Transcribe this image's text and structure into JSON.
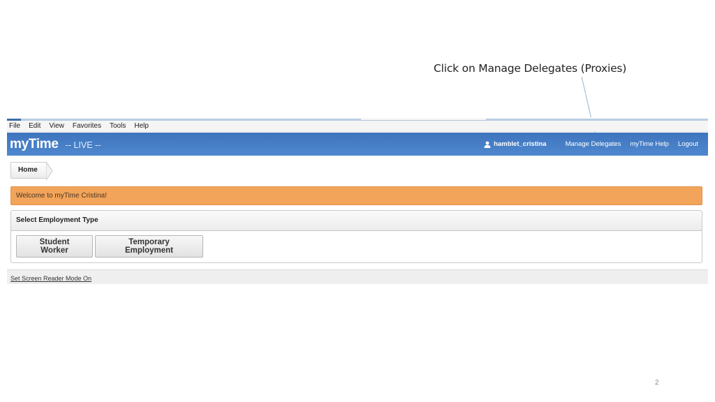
{
  "annotation": {
    "callout_text": "Click on Manage Delegates (Proxies)"
  },
  "browser": {
    "menu": [
      "File",
      "Edit",
      "View",
      "Favorites",
      "Tools",
      "Help"
    ]
  },
  "app": {
    "title": "myTime",
    "environment": "-- LIVE --",
    "username": "hamblet_cristina",
    "user_icon": "user-icon",
    "nav_links": [
      "Manage Delegates",
      "myTime Help",
      "Logout"
    ]
  },
  "breadcrumb": {
    "home": "Home"
  },
  "welcome_message": "Welcome to myTime Cristina!",
  "employment_panel": {
    "header": "Select Employment Type",
    "buttons": [
      "Student Worker",
      "Temporary Employment"
    ]
  },
  "footer": {
    "screen_reader_link": "Set Screen Reader Mode On"
  },
  "slide": {
    "number": "2"
  },
  "colors": {
    "app_bar": "#4a80c8",
    "welcome_bg": "#f2a45b",
    "callout_line": "#7fa3c9"
  }
}
